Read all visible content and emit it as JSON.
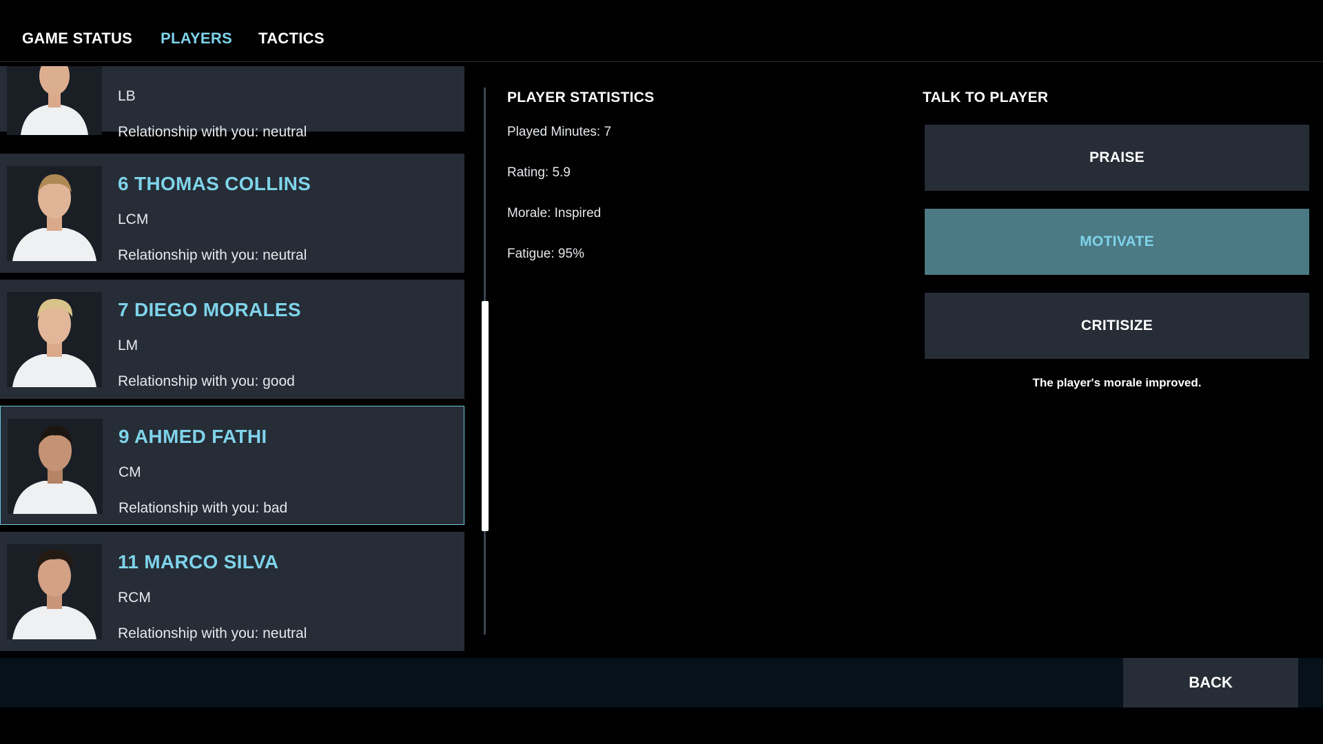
{
  "nav": {
    "tabs": [
      {
        "label": "GAME STATUS",
        "active": false
      },
      {
        "label": "PLAYERS",
        "active": true
      },
      {
        "label": "TACTICS",
        "active": false
      }
    ]
  },
  "players": [
    {
      "name": "",
      "position": "LB",
      "relationship": "Relationship with you: neutral",
      "selected": false,
      "hair": "#6b4a2e"
    },
    {
      "name": "6 THOMAS COLLINS",
      "position": "LCM",
      "relationship": "Relationship with you: neutral",
      "selected": false,
      "hair": "#b08a55"
    },
    {
      "name": "7 DIEGO MORALES",
      "position": "LM",
      "relationship": "Relationship with you: good",
      "selected": false,
      "hair": "#d8c38a"
    },
    {
      "name": "9 AHMED FATHI",
      "position": "CM",
      "relationship": "Relationship with you: bad",
      "selected": true,
      "hair": "#1c1612"
    },
    {
      "name": "11 MARCO SILVA",
      "position": "RCM",
      "relationship": "Relationship with you: neutral",
      "selected": false,
      "hair": "#241a14"
    }
  ],
  "stats": {
    "title": "PLAYER STATISTICS",
    "played_minutes": "Played Minutes: 7",
    "rating": "Rating: 5.9",
    "morale": "Morale: Inspired",
    "fatigue": "Fatigue: 95%"
  },
  "talk": {
    "title": "TALK TO PLAYER",
    "praise": "PRAISE",
    "motivate": "MOTIVATE",
    "critisize": "CRITISIZE",
    "message": "The player's morale improved."
  },
  "footer": {
    "back": "BACK"
  },
  "colors": {
    "accent": "#7fd3ea",
    "card_bg": "#262d36",
    "active_button": "#4b7a84"
  }
}
